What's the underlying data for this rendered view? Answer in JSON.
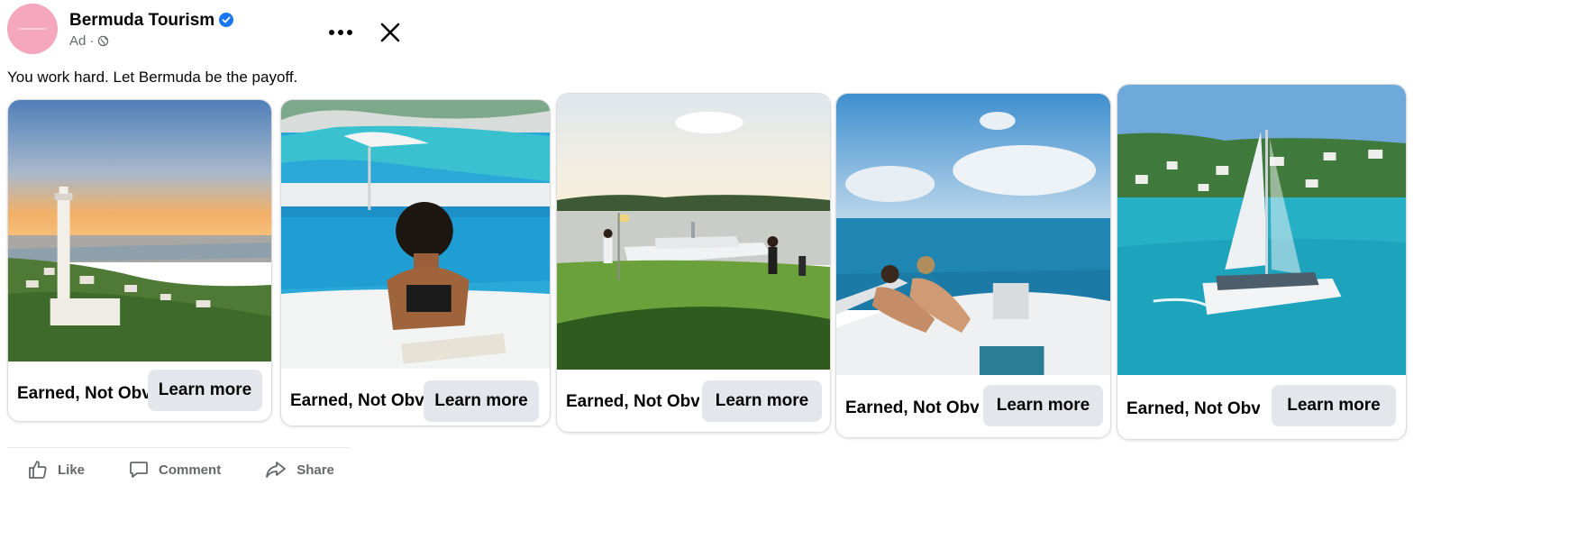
{
  "post": {
    "page_name": "Bermuda Tourism",
    "sponsored_label": "Ad ·",
    "caption": "You work hard. Let Bermuda be the payoff."
  },
  "carousel": [
    {
      "headline": "Earned, Not Obvious",
      "cta": "Learn more",
      "image": "lighthouse-sunset-photo"
    },
    {
      "headline": "Earned, Not Obvious",
      "cta": "Learn more",
      "image": "woman-pool-edge-photo"
    },
    {
      "headline": "Earned, Not Obvious",
      "cta": "Learn more",
      "image": "golf-green-yacht-photo"
    },
    {
      "headline": "Earned, Not Obvious",
      "cta": "Learn more",
      "image": "couple-boat-bow-photo"
    },
    {
      "headline": "Earned, Not Obvious",
      "cta": "Learn more",
      "image": "catamaran-bay-photo"
    }
  ],
  "actions": {
    "like": "Like",
    "comment": "Comment",
    "share": "Share"
  },
  "colors": {
    "verified": "#1877f2",
    "avatar": "#f4a6bd",
    "button_bg": "#e4e6eb",
    "muted_text": "#65676b"
  },
  "icons": [
    "verified-badge-icon",
    "globe-icon",
    "more-options-icon",
    "close-icon",
    "like-icon",
    "comment-icon",
    "share-icon"
  ]
}
